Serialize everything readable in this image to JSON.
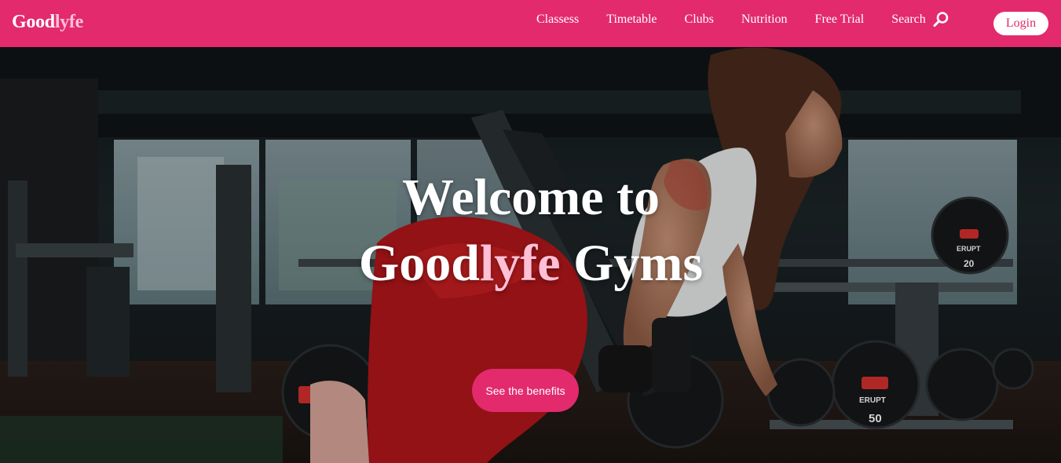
{
  "brand": {
    "name_part1": "Good",
    "name_part2": "lyfe"
  },
  "nav": {
    "items": [
      {
        "label": "Classess"
      },
      {
        "label": "Timetable"
      },
      {
        "label": "Clubs"
      },
      {
        "label": "Nutrition"
      },
      {
        "label": "Free Trial"
      }
    ],
    "search_label": "Search",
    "login_label": "Login"
  },
  "hero": {
    "title_line1": "Welcome to",
    "title_part1": "Good",
    "title_part2": "lyfe",
    "title_part3": " Gyms",
    "cta_label": "See the benefits",
    "image": "woman-with-dumbbell-gym-photo",
    "plate_labels": [
      "ERUPT",
      "20",
      "ERUPT",
      "50"
    ]
  },
  "colors": {
    "brand_pink": "#e32a6d",
    "accent_light_pink": "#ffc0d6",
    "white": "#ffffff"
  },
  "icons": {
    "search": "search-icon"
  }
}
